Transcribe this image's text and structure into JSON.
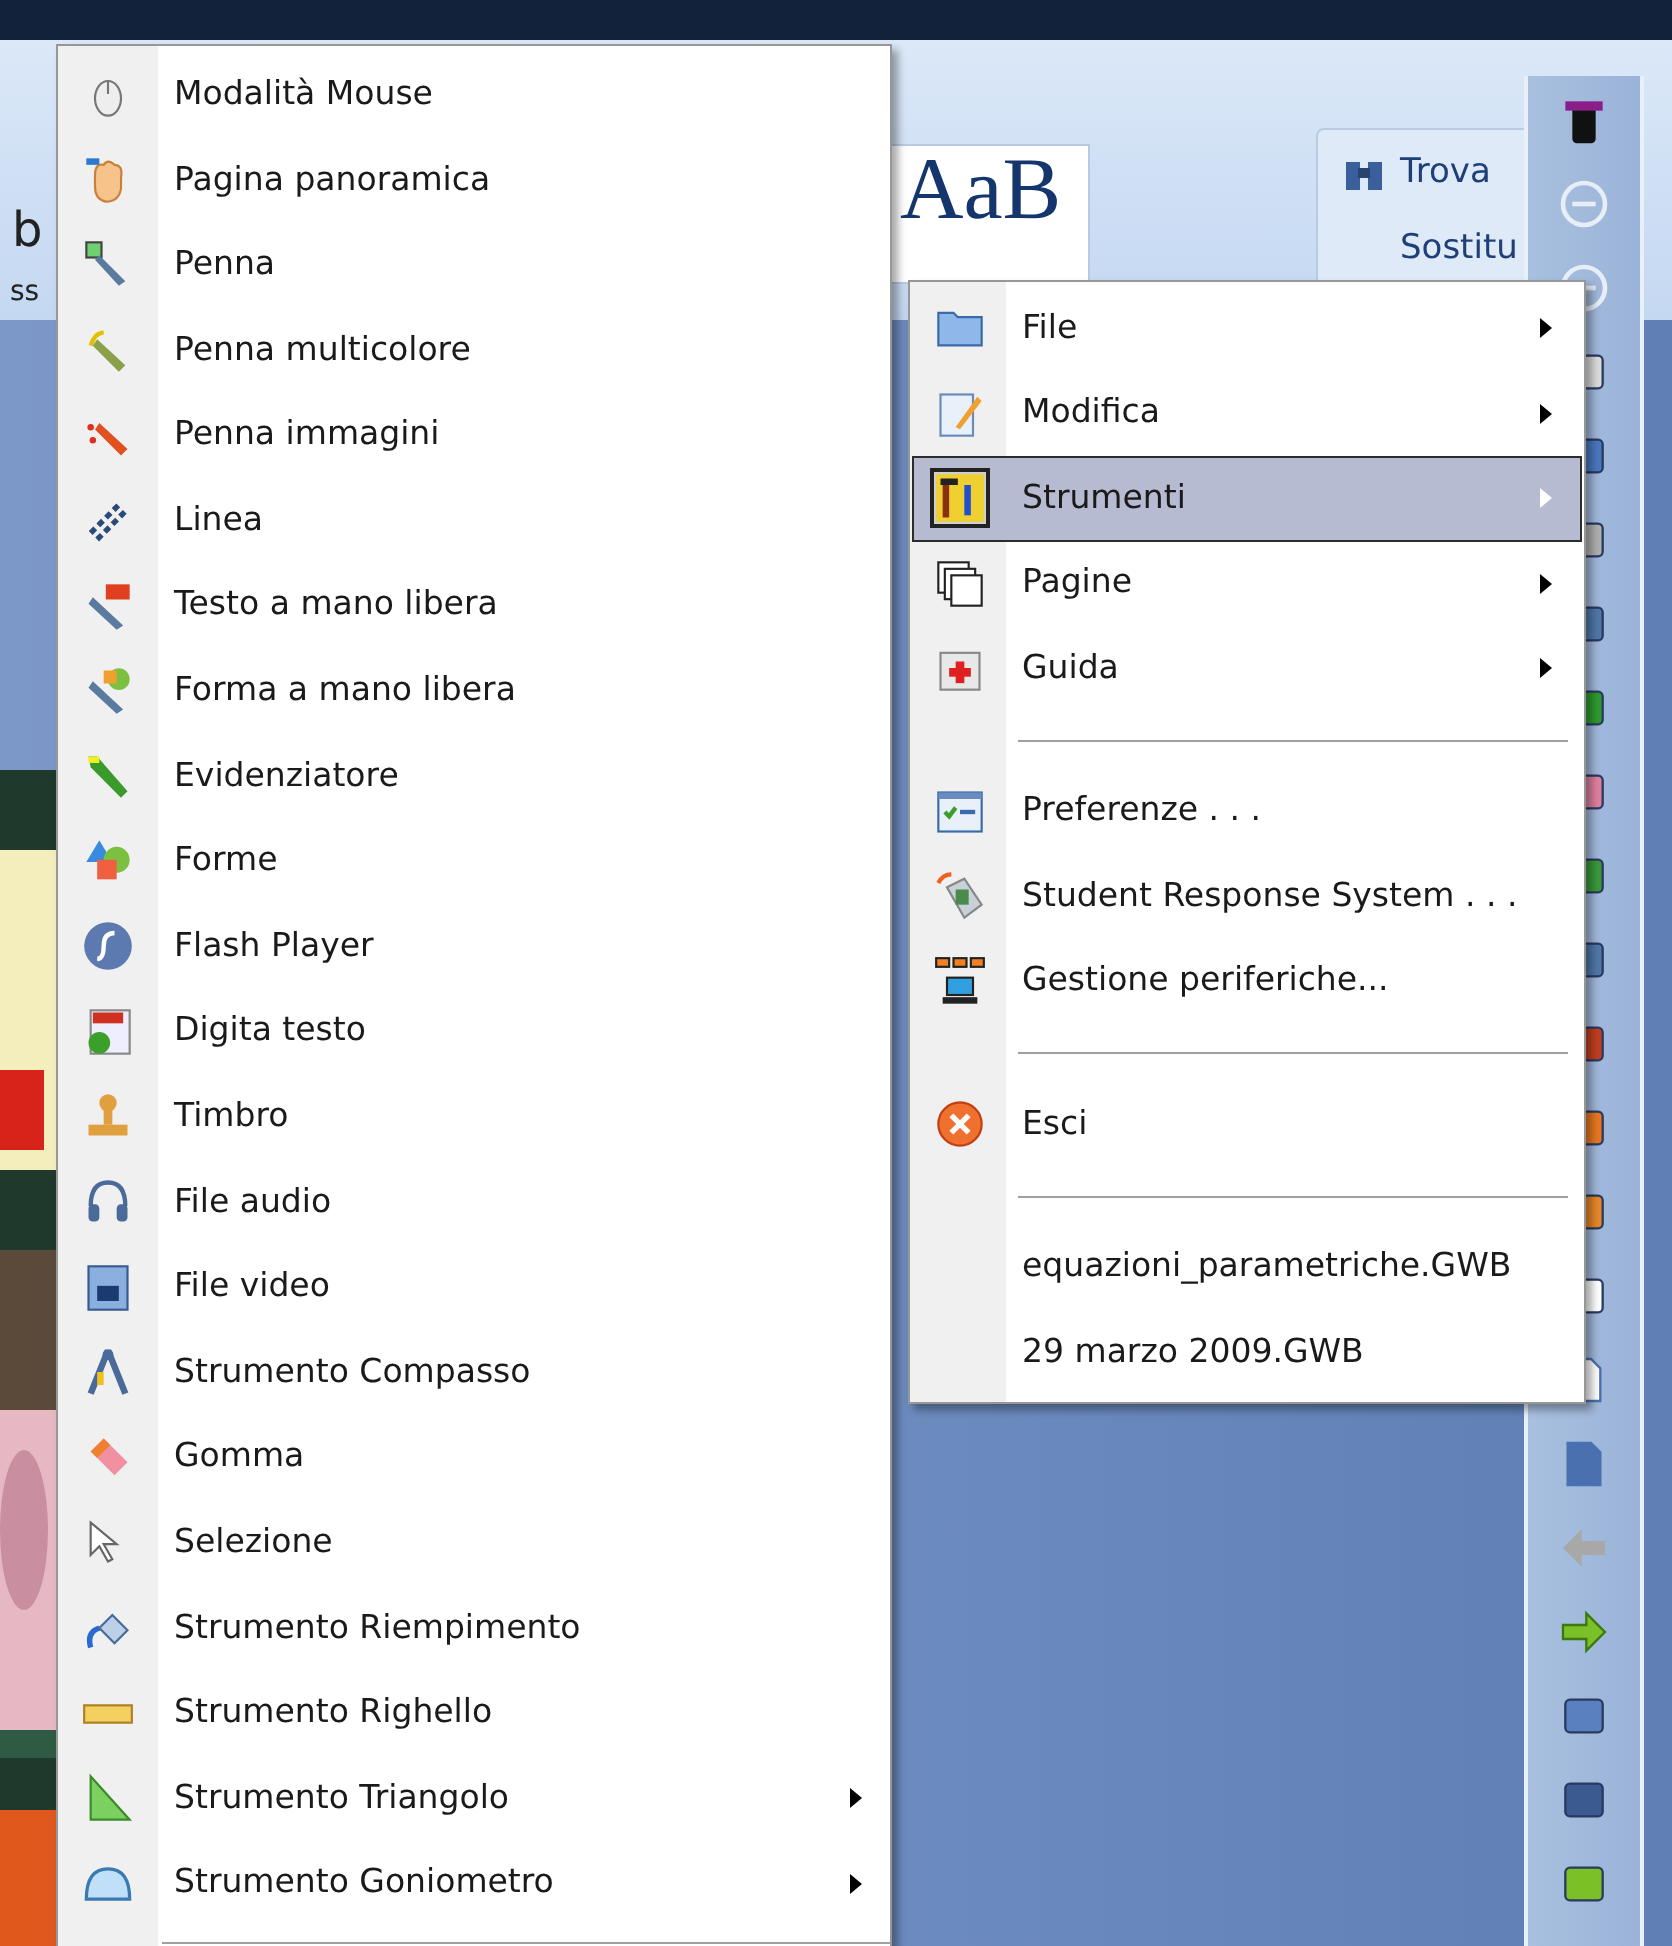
{
  "ribbon": {
    "style_sample": "AaB",
    "find": "Trova",
    "replace": "Sostitu",
    "cut_texts": [
      "b",
      "ss"
    ]
  },
  "tools_menu": {
    "items": [
      {
        "kind": "item",
        "label": "Modalità Mouse",
        "submenu": false
      },
      {
        "kind": "item",
        "label": "Pagina panoramica",
        "submenu": false
      },
      {
        "kind": "item",
        "label": "Penna",
        "submenu": false
      },
      {
        "kind": "item",
        "label": "Penna multicolore",
        "submenu": false
      },
      {
        "kind": "item",
        "label": "Penna immagini",
        "submenu": false
      },
      {
        "kind": "item",
        "label": "Linea",
        "submenu": false
      },
      {
        "kind": "item",
        "label": "Testo a mano libera",
        "submenu": false
      },
      {
        "kind": "item",
        "label": "Forma a mano libera",
        "submenu": false
      },
      {
        "kind": "item",
        "label": "Evidenziatore",
        "submenu": false
      },
      {
        "kind": "item",
        "label": "Forme",
        "submenu": false
      },
      {
        "kind": "item",
        "label": "Flash Player",
        "submenu": false
      },
      {
        "kind": "item",
        "label": "Digita testo",
        "submenu": false
      },
      {
        "kind": "item",
        "label": "Timbro",
        "submenu": false
      },
      {
        "kind": "item",
        "label": "File audio",
        "submenu": false
      },
      {
        "kind": "item",
        "label": "File video",
        "submenu": false
      },
      {
        "kind": "item",
        "label": "Strumento Compasso",
        "submenu": false
      },
      {
        "kind": "item",
        "label": "Gomma",
        "submenu": false
      },
      {
        "kind": "item",
        "label": "Selezione",
        "submenu": false
      },
      {
        "kind": "item",
        "label": "Strumento Riempimento",
        "submenu": false
      },
      {
        "kind": "item",
        "label": "Strumento Righello",
        "submenu": false
      },
      {
        "kind": "item",
        "label": "Strumento Triangolo",
        "submenu": true
      },
      {
        "kind": "item",
        "label": "Strumento Goniometro",
        "submenu": true
      },
      {
        "kind": "separator"
      }
    ]
  },
  "main_menu": {
    "items": [
      {
        "kind": "item",
        "label": "File",
        "submenu": true,
        "selected": false
      },
      {
        "kind": "item",
        "label": "Modifica",
        "submenu": true,
        "selected": false
      },
      {
        "kind": "item",
        "label": "Strumenti",
        "submenu": true,
        "selected": true
      },
      {
        "kind": "item",
        "label": "Pagine",
        "submenu": true,
        "selected": false
      },
      {
        "kind": "item",
        "label": "Guida",
        "submenu": true,
        "selected": false
      },
      {
        "kind": "separator"
      },
      {
        "kind": "item",
        "label": "Preferenze . . .",
        "submenu": false,
        "selected": false
      },
      {
        "kind": "item",
        "label": "Student Response System . . .",
        "submenu": false,
        "selected": false
      },
      {
        "kind": "item",
        "label": "Gestione periferiche...",
        "submenu": false,
        "selected": false
      },
      {
        "kind": "separator"
      },
      {
        "kind": "item",
        "label": "Esci",
        "submenu": false,
        "selected": false
      },
      {
        "kind": "separator"
      },
      {
        "kind": "recent",
        "label": "equazioni_parametriche.GWB",
        "selected": false
      },
      {
        "kind": "recent",
        "label": "29 marzo 2009.GWB",
        "selected": false
      }
    ]
  }
}
